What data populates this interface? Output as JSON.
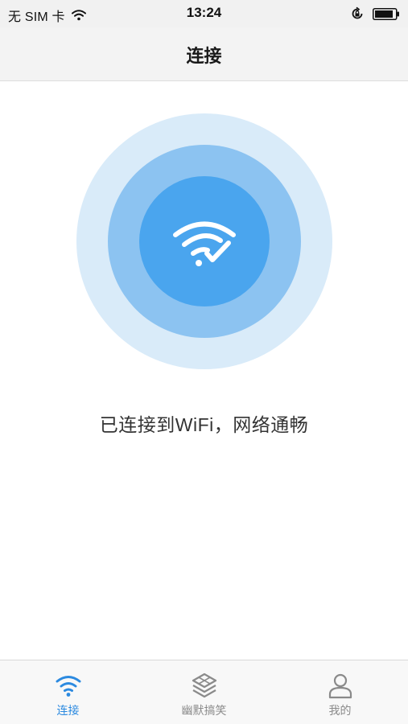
{
  "status_bar": {
    "carrier": "无 SIM 卡",
    "time": "13:24",
    "icons": [
      "wifi-icon",
      "rotation-lock-icon",
      "battery-icon"
    ]
  },
  "nav": {
    "title": "连接"
  },
  "main": {
    "icon": "wifi-connected-icon",
    "message": "已连接到WiFi，网络通畅"
  },
  "tab_bar": {
    "active_tab": 0,
    "tabs": [
      {
        "label": "连接",
        "icon": "wifi-icon"
      },
      {
        "label": "幽默搞笑",
        "icon": "layers-icon"
      },
      {
        "label": "我的",
        "icon": "person-icon"
      }
    ]
  },
  "colors": {
    "accent": "#2c8ae0",
    "ring_outer": "#d9ebf9",
    "ring_middle": "#8cc3f1",
    "ring_inner": "#4aa5ee",
    "inactive": "#8a8a8a"
  }
}
